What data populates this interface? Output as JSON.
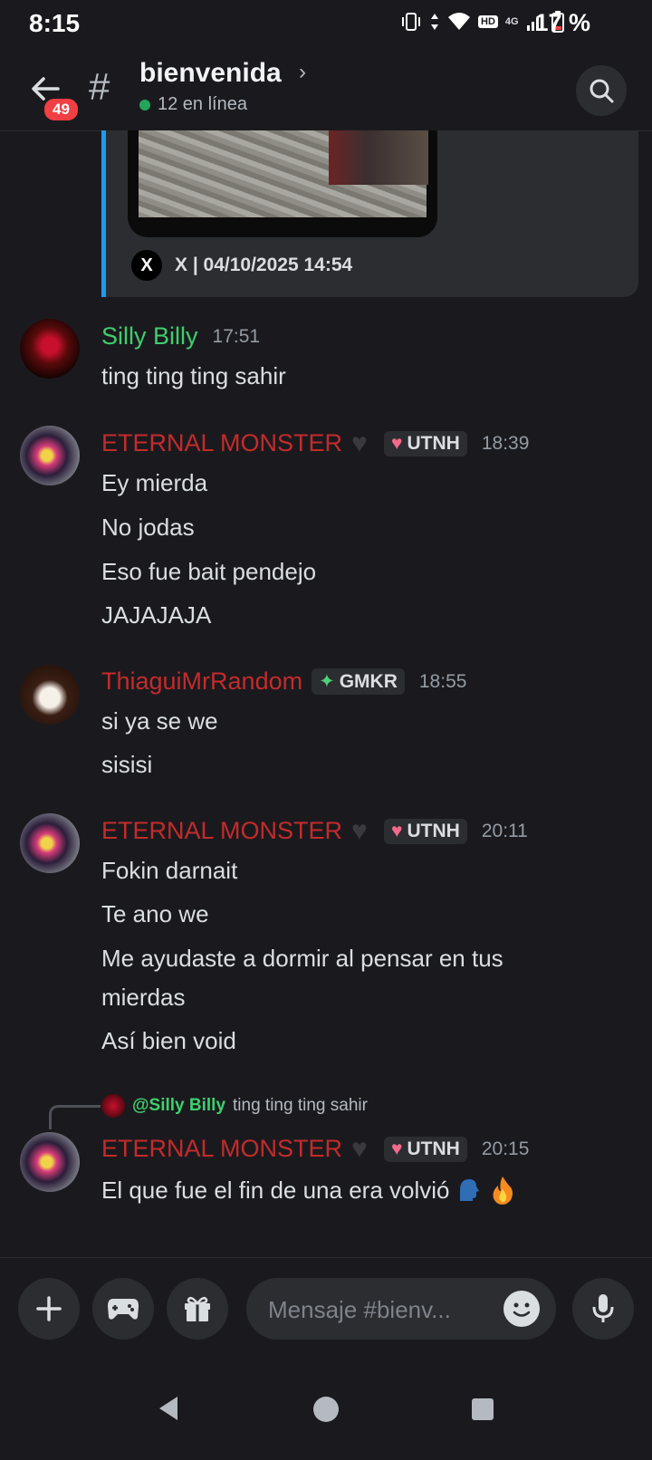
{
  "status_bar": {
    "time": "8:15",
    "battery": "17 %",
    "network": "4G",
    "hd": "HD"
  },
  "header": {
    "unread_count": "49",
    "channel_name": "bienvenida",
    "online_count": "12 en línea"
  },
  "embed": {
    "footer": "X | 04/10/2025 14:54",
    "source_icon": "X"
  },
  "messages": [
    {
      "author": "Silly Billy",
      "time": "17:51",
      "lines": [
        "ting ting ting sahir"
      ]
    },
    {
      "author": "ETERNAL MONSTER",
      "tag": "UTNH",
      "time": "18:39",
      "lines": [
        "Ey mierda",
        "No jodas",
        "Eso fue bait pendejo",
        "JAJAJAJA"
      ]
    },
    {
      "author": "ThiaguiMrRandom",
      "tag": "GMKR",
      "time": "18:55",
      "lines": [
        "si ya se we",
        "sisisi"
      ]
    },
    {
      "author": "ETERNAL MONSTER",
      "tag": "UTNH",
      "time": "20:11",
      "lines": [
        "Fokin darnait",
        "Te ano we",
        "Me ayudaste a dormir al pensar en tus",
        "mierdas",
        "Así bien void"
      ]
    },
    {
      "author": "ETERNAL MONSTER",
      "tag": "UTNH",
      "time": "20:15",
      "reply_to": "@Silly Billy",
      "reply_text": "ting ting ting sahir",
      "lines": [
        "El que fue el fin de una era volvió"
      ]
    }
  ],
  "composer": {
    "placeholder": "Mensaje #bienv..."
  },
  "colors": {
    "accent_green": "#3ecf6d",
    "accent_red": "#c42b2b",
    "link_blue": "#1e9bf0",
    "badge_red": "#f23f43"
  }
}
